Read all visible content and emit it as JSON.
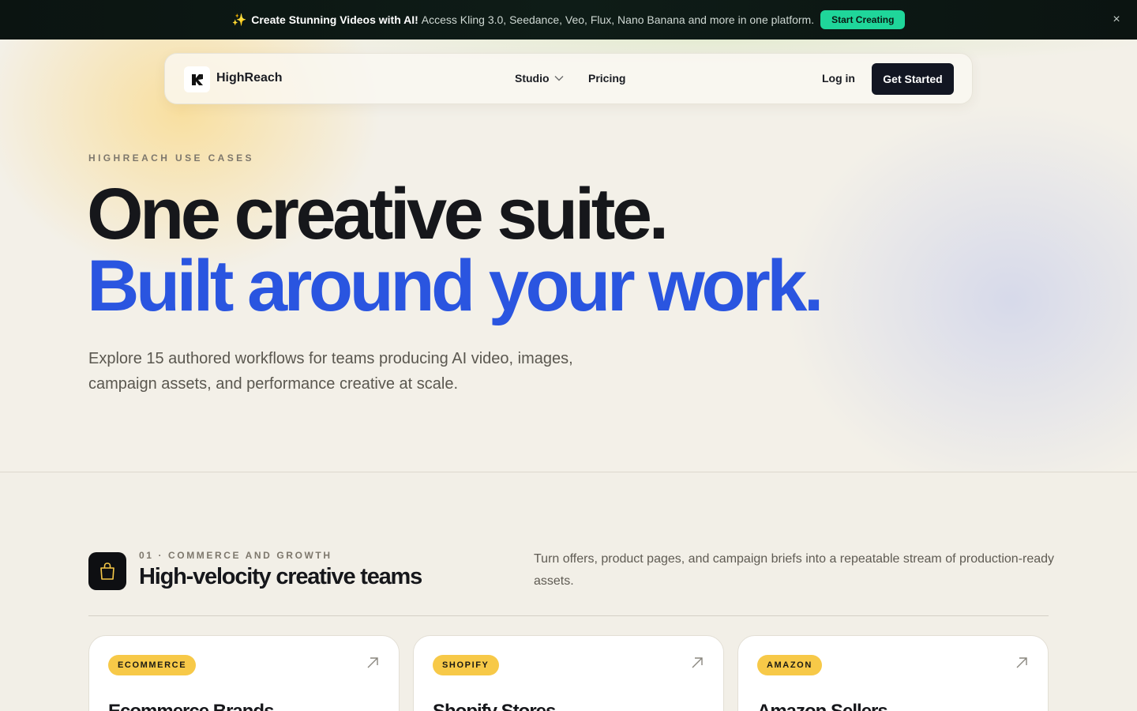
{
  "announcement": {
    "emoji": "✨",
    "headline": "Create Stunning Videos with AI!",
    "text": "Access Kling 3.0, Seedance, Veo, Flux, Nano Banana and more in one platform.",
    "cta_label": "Start Creating",
    "close_symbol": "×"
  },
  "nav": {
    "brand": "HighReach",
    "studio_label": "Studio",
    "pricing_label": "Pricing",
    "login_label": "Log in",
    "get_started_label": "Get Started"
  },
  "hero": {
    "eyebrow": "HIGHREACH USE CASES",
    "headline_line1": "One creative suite.",
    "headline_line2": "Built around your work.",
    "subtext": "Explore 15 authored workflows for teams producing AI video, images, campaign assets, and performance creative at scale."
  },
  "section": {
    "eyebrow": "01 · COMMERCE AND GROWTH",
    "title": "High-velocity creative teams",
    "description": "Turn offers, product pages, and campaign briefs into a repeatable stream of production-ready assets.",
    "icon": "shopping-bag-icon"
  },
  "cards": [
    {
      "tag": "ECOMMERCE",
      "title": "Ecommerce Brands"
    },
    {
      "tag": "SHOPIFY",
      "title": "Shopify Stores"
    },
    {
      "tag": "AMAZON",
      "title": "Amazon Sellers"
    }
  ],
  "colors": {
    "accent_blue": "#2a55e0",
    "cta_green": "#1fd69a",
    "tag_yellow": "#f7c948",
    "dark": "#121622"
  }
}
